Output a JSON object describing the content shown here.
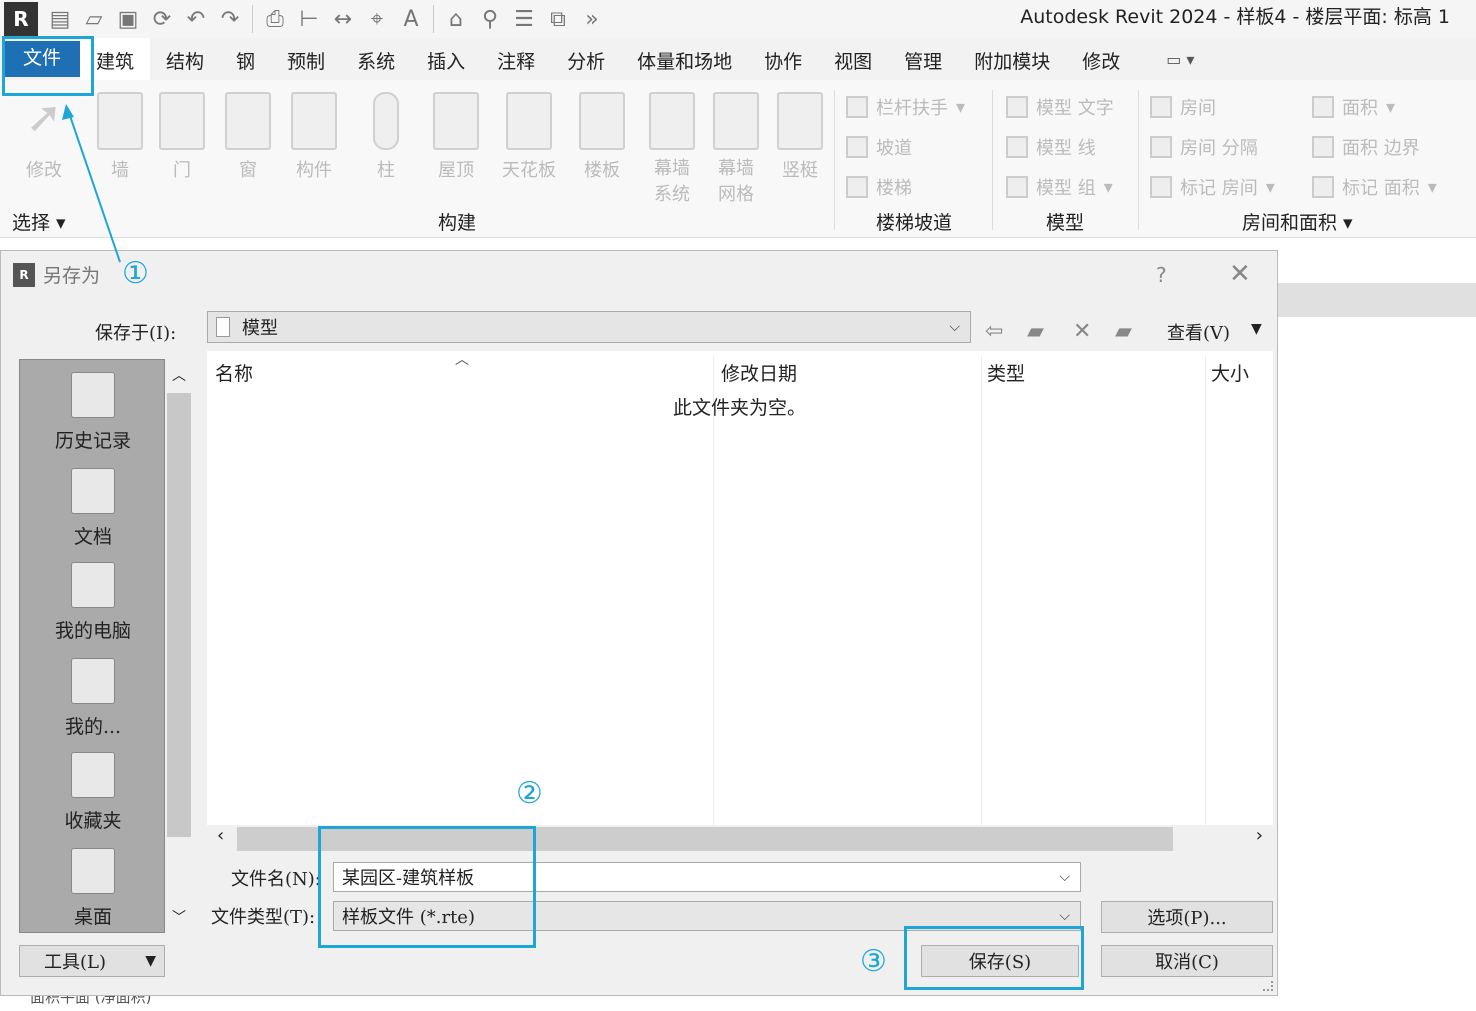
{
  "app": {
    "logo": "R",
    "title": "Autodesk Revit 2024 - 样板4 - 楼层平面: 标高 1"
  },
  "tabs": [
    "文件",
    "建筑",
    "结构",
    "钢",
    "预制",
    "系统",
    "插入",
    "注释",
    "分析",
    "体量和场地",
    "协作",
    "视图",
    "管理",
    "附加模块",
    "修改"
  ],
  "ribbon": {
    "buttons": [
      "修改",
      "墙",
      "门",
      "窗",
      "构件",
      "柱",
      "屋顶",
      "天花板",
      "楼板",
      "幕墙\n系统",
      "幕墙\n网格",
      "竖梃"
    ],
    "stairs": [
      "栏杆扶手",
      "坡道",
      "楼梯"
    ],
    "model": [
      "模型 文字",
      "模型 线",
      "模型 组"
    ],
    "rooms": [
      "房间",
      "房间 分隔",
      "标记 房间",
      "面积",
      "面积 边界",
      "标记 面积"
    ],
    "groups": [
      "选择",
      "构建",
      "楼梯坡道",
      "模型",
      "房间和面积"
    ]
  },
  "dialog": {
    "title": "另存为",
    "help": "?",
    "close": "✕",
    "save_in_label": "保存于(I):",
    "save_in_value": "模型",
    "view_label": "查看(V)",
    "places": [
      "历史记录",
      "文档",
      "我的电脑",
      "我的...",
      "收藏夹",
      "桌面"
    ],
    "columns": [
      "名称",
      "修改日期",
      "类型",
      "大小"
    ],
    "empty_text": "此文件夹为空。",
    "filename_label": "文件名(N):",
    "filename_value": "某园区-建筑样板",
    "filetype_label": "文件类型(T):",
    "filetype_value": "样板文件 (*.rte)",
    "options_button": "选项(P)...",
    "save_button": "保存(S)",
    "cancel_button": "取消(C)",
    "tools_button": "工具(L)"
  },
  "annotations": {
    "one": "①",
    "two": "②",
    "three": "③",
    "accent": "#1ea6d6"
  },
  "background": {
    "tree_text": "面积平面 (净面积)"
  }
}
